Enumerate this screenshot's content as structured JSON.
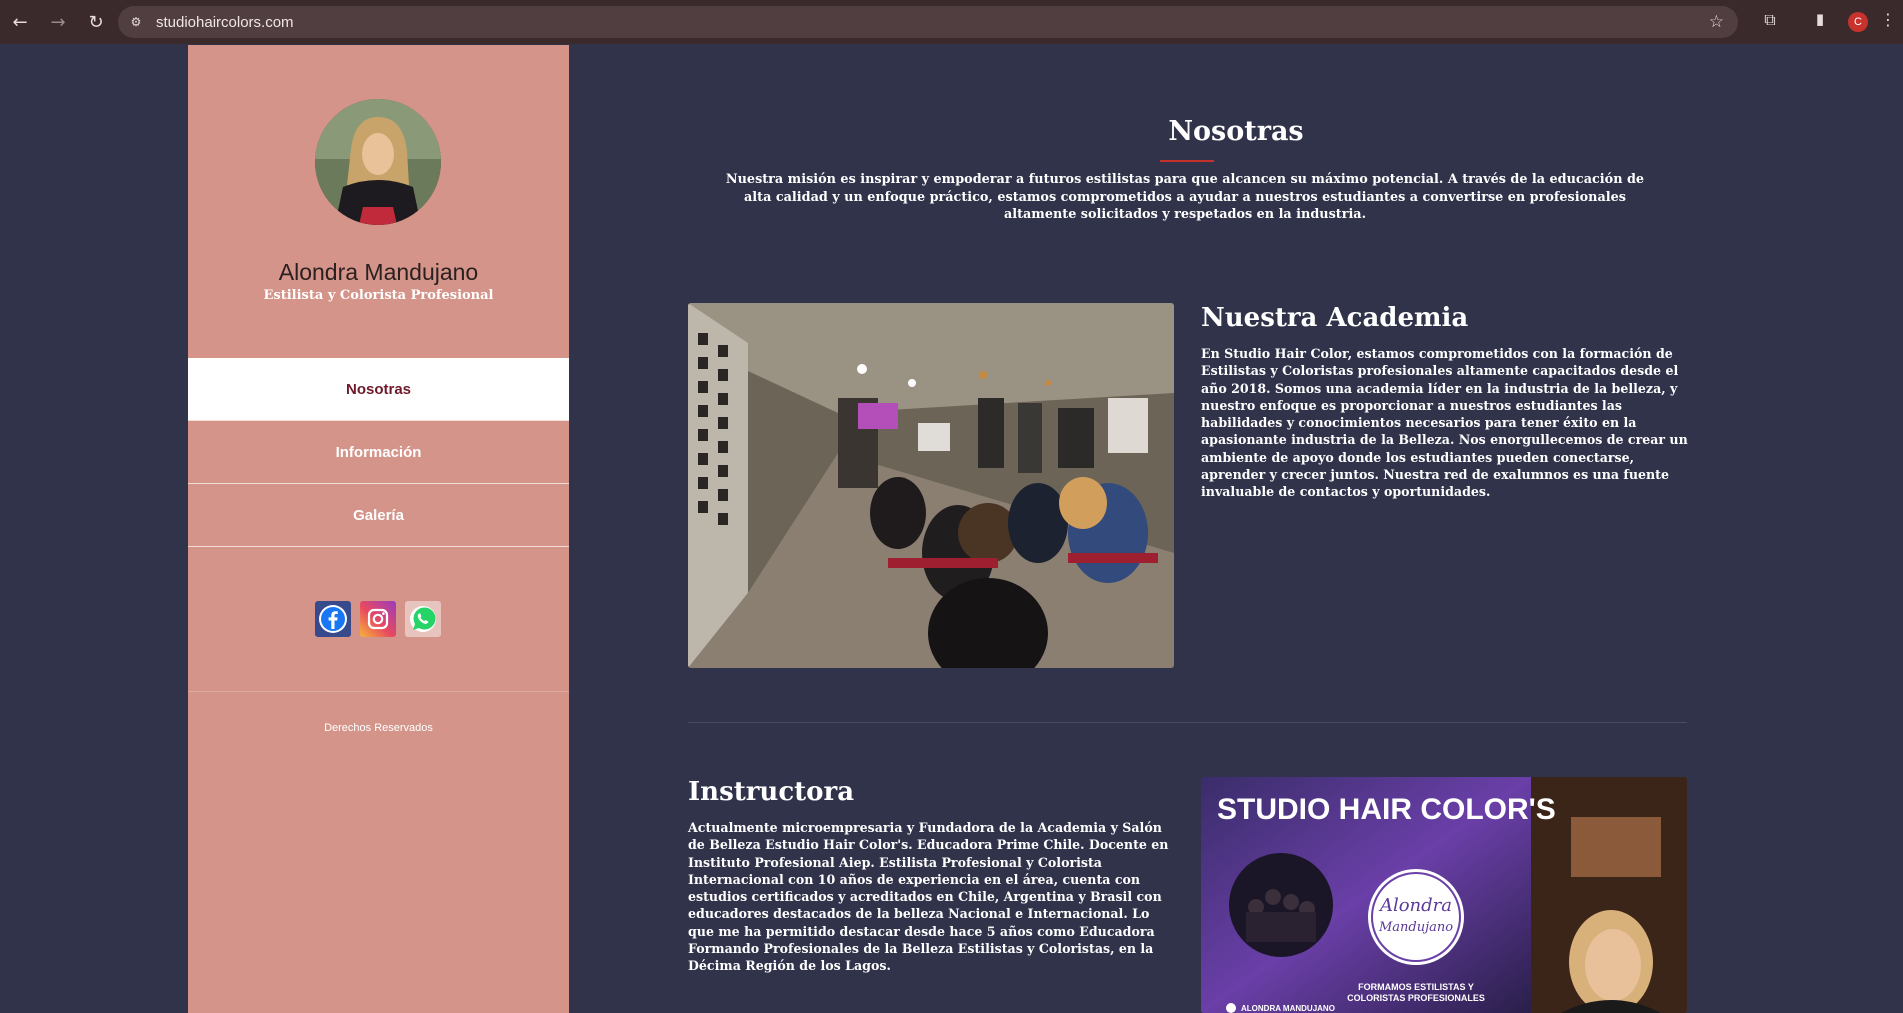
{
  "browser": {
    "url": "studiohaircolors.com",
    "profile_initial": "C"
  },
  "sidebar": {
    "name": "Alondra Mandujano",
    "role": "Estilista y Colorista Profesional",
    "nav": [
      {
        "label": "Nosotras",
        "active": true
      },
      {
        "label": "Información",
        "active": false
      },
      {
        "label": "Galería",
        "active": false
      }
    ],
    "socials": [
      "facebook-icon",
      "instagram-icon",
      "whatsapp-icon"
    ],
    "copyright": "Derechos Reservados"
  },
  "main": {
    "title": "Nosotras",
    "intro": "Nuestra misión es inspirar y empoderar a futuros estilistas para que alcancen su máximo potencial. A través de la educación de alta calidad y un enfoque práctico, estamos comprometidos a ayudar a nuestros estudiantes a convertirse en profesionales altamente solicitados y respetados en la industria.",
    "academy": {
      "heading": "Nuestra Academia",
      "text": "En Studio Hair Color, estamos comprometidos con la formación de Estilistas y Coloristas profesionales altamente capacitados desde el año 2018. Somos una academia líder en la industria de la belleza, y nuestro enfoque es proporcionar a nuestros estudiantes las habilidades y conocimientos necesarios para tener éxito en la apasionante industria de la Belleza. Nos enorgullecemos de crear un ambiente de apoyo donde los estudiantes pueden conectarse, aprender y crecer juntos. Nuestra red de exalumnos es una fuente invaluable de contactos y oportunidades."
    },
    "instructor": {
      "heading": "Instructora",
      "text": "Actualmente microempresaria y Fundadora de la Academia y Salón de Belleza Estudio Hair Color's. Educadora Prime Chile. Docente en Instituto Profesional Aiep. Estilista Profesional y Colorista Internacional con 10 años de experiencia en el área, cuenta con estudios certificados y acreditados en Chile, Argentina y Brasil con educadores destacados de la belleza Nacional e Internacional. Lo que me ha permitido destacar desde hace 5 años como Educadora Formando Profesionales de la Belleza Estilistas y Coloristas, en la Décima Región de los Lagos."
    },
    "banner": {
      "headline": "STUDIO HAIR COLOR'S",
      "logo_line1": "Alondra",
      "logo_line2": "Mandujano",
      "tagline_1": "FORMAMOS ESTILISTAS Y",
      "tagline_2": "COLORISTAS PROFESIONALES",
      "handle": "ALONDRA MANDUJANO"
    }
  }
}
